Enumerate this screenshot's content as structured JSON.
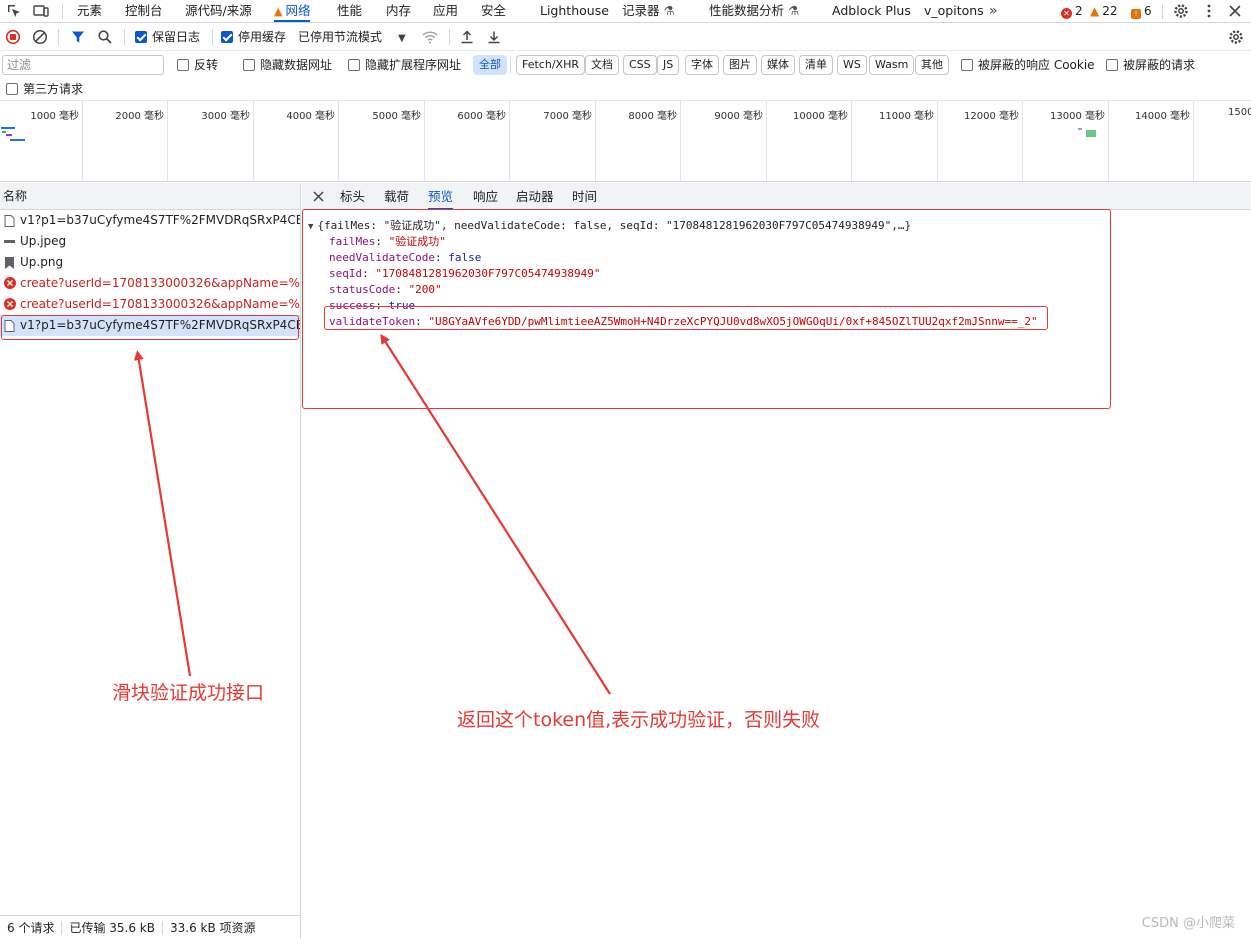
{
  "devtools_tabs": [
    {
      "label": "元素"
    },
    {
      "label": "控制台"
    },
    {
      "label": "源代码/来源"
    },
    {
      "label": "网络"
    },
    {
      "label": "性能"
    },
    {
      "label": "内存"
    },
    {
      "label": "应用"
    },
    {
      "label": "安全"
    },
    {
      "label": "Lighthouse"
    },
    {
      "label": "记录器"
    },
    {
      "label": "性能数据分析"
    },
    {
      "label": "Adblock Plus"
    },
    {
      "label": "v_opitons"
    }
  ],
  "counts": {
    "errors": "2",
    "warnings": "22",
    "issues": "6"
  },
  "toolbar": {
    "preserve_log": "保留日志",
    "disable_cache": "停用缓存",
    "throttling": "已停用节流模式"
  },
  "filter": {
    "placeholder": "过滤",
    "invert": "反转",
    "hide_data_urls": "隐藏数据网址",
    "hide_extension_urls": "隐藏扩展程序网址",
    "types": [
      "全部",
      "Fetch/XHR",
      "文档",
      "CSS",
      "JS",
      "字体",
      "图片",
      "媒体",
      "清单",
      "WS",
      "Wasm",
      "其他"
    ],
    "blocked_cookies": "被屏蔽的响应 Cookie",
    "blocked_requests": "被屏蔽的请求",
    "third_party": "第三方请求"
  },
  "timeline_ticks": [
    "1000 毫秒",
    "2000 毫秒",
    "3000 毫秒",
    "4000 毫秒",
    "5000 毫秒",
    "6000 毫秒",
    "7000 毫秒",
    "8000 毫秒",
    "9000 毫秒",
    "10000 毫秒",
    "11000 毫秒",
    "12000 毫秒",
    "13000 毫秒",
    "14000 毫秒",
    "1500"
  ],
  "request_list": {
    "header": "名称",
    "rows": [
      {
        "name": "v1?p1=b37uCyfyme4S7TF%2FMVDRqSRxP4CB2Bj...",
        "icon": "document-icon",
        "status": "ok"
      },
      {
        "name": "Up.jpeg",
        "icon": "image-icon",
        "status": "ok"
      },
      {
        "name": "Up.png",
        "icon": "image-icon",
        "status": "ok"
      },
      {
        "name": "create?userId=1708133000326&appName=%E5%...",
        "icon": "error-icon",
        "status": "error"
      },
      {
        "name": "create?userId=1708133000326&appName=%E5%...",
        "icon": "error-icon",
        "status": "error"
      },
      {
        "name": "v1?p1=b37uCyfyme4S7TF%2FMVDRqSRxP4CB2Bj...",
        "icon": "document-icon",
        "status": "selected"
      }
    ],
    "footer": {
      "requests": "6 个请求",
      "transferred": "已传输 35.6 kB",
      "resources": "33.6 kB 项资源"
    }
  },
  "detail_tabs": [
    {
      "label": "标头"
    },
    {
      "label": "载荷"
    },
    {
      "label": "预览"
    },
    {
      "label": "响应"
    },
    {
      "label": "启动器"
    },
    {
      "label": "时间"
    }
  ],
  "preview": {
    "summary": "{failMes: \"验证成功\", needValidateCode: false, seqId: \"1708481281962030F797C05474938949\",…}",
    "fields": [
      {
        "key": "failMes",
        "value": "\"验证成功\"",
        "kind": "str"
      },
      {
        "key": "needValidateCode",
        "value": "false",
        "kind": "bool"
      },
      {
        "key": "seqId",
        "value": "\"1708481281962030F797C05474938949\"",
        "kind": "str"
      },
      {
        "key": "statusCode",
        "value": "\"200\"",
        "kind": "str"
      },
      {
        "key": "success",
        "value": "true",
        "kind": "bool"
      },
      {
        "key": "validateToken",
        "value": "\"U8GYaAVfe6YDD/pwMlimtieeAZ5WmoH+N4DrzeXcPYQJU0vd8wXO5jOWGOqUi/0xf+845OZlTUU2qxf2mJSnnw==_2\"",
        "kind": "str"
      }
    ]
  },
  "annotations": {
    "slider_api": "滑块验证成功接口",
    "token_note": "返回这个token值,表示成功验证，否则失败",
    "color": "#e53935"
  },
  "watermark": "CSDN @小爬菜"
}
